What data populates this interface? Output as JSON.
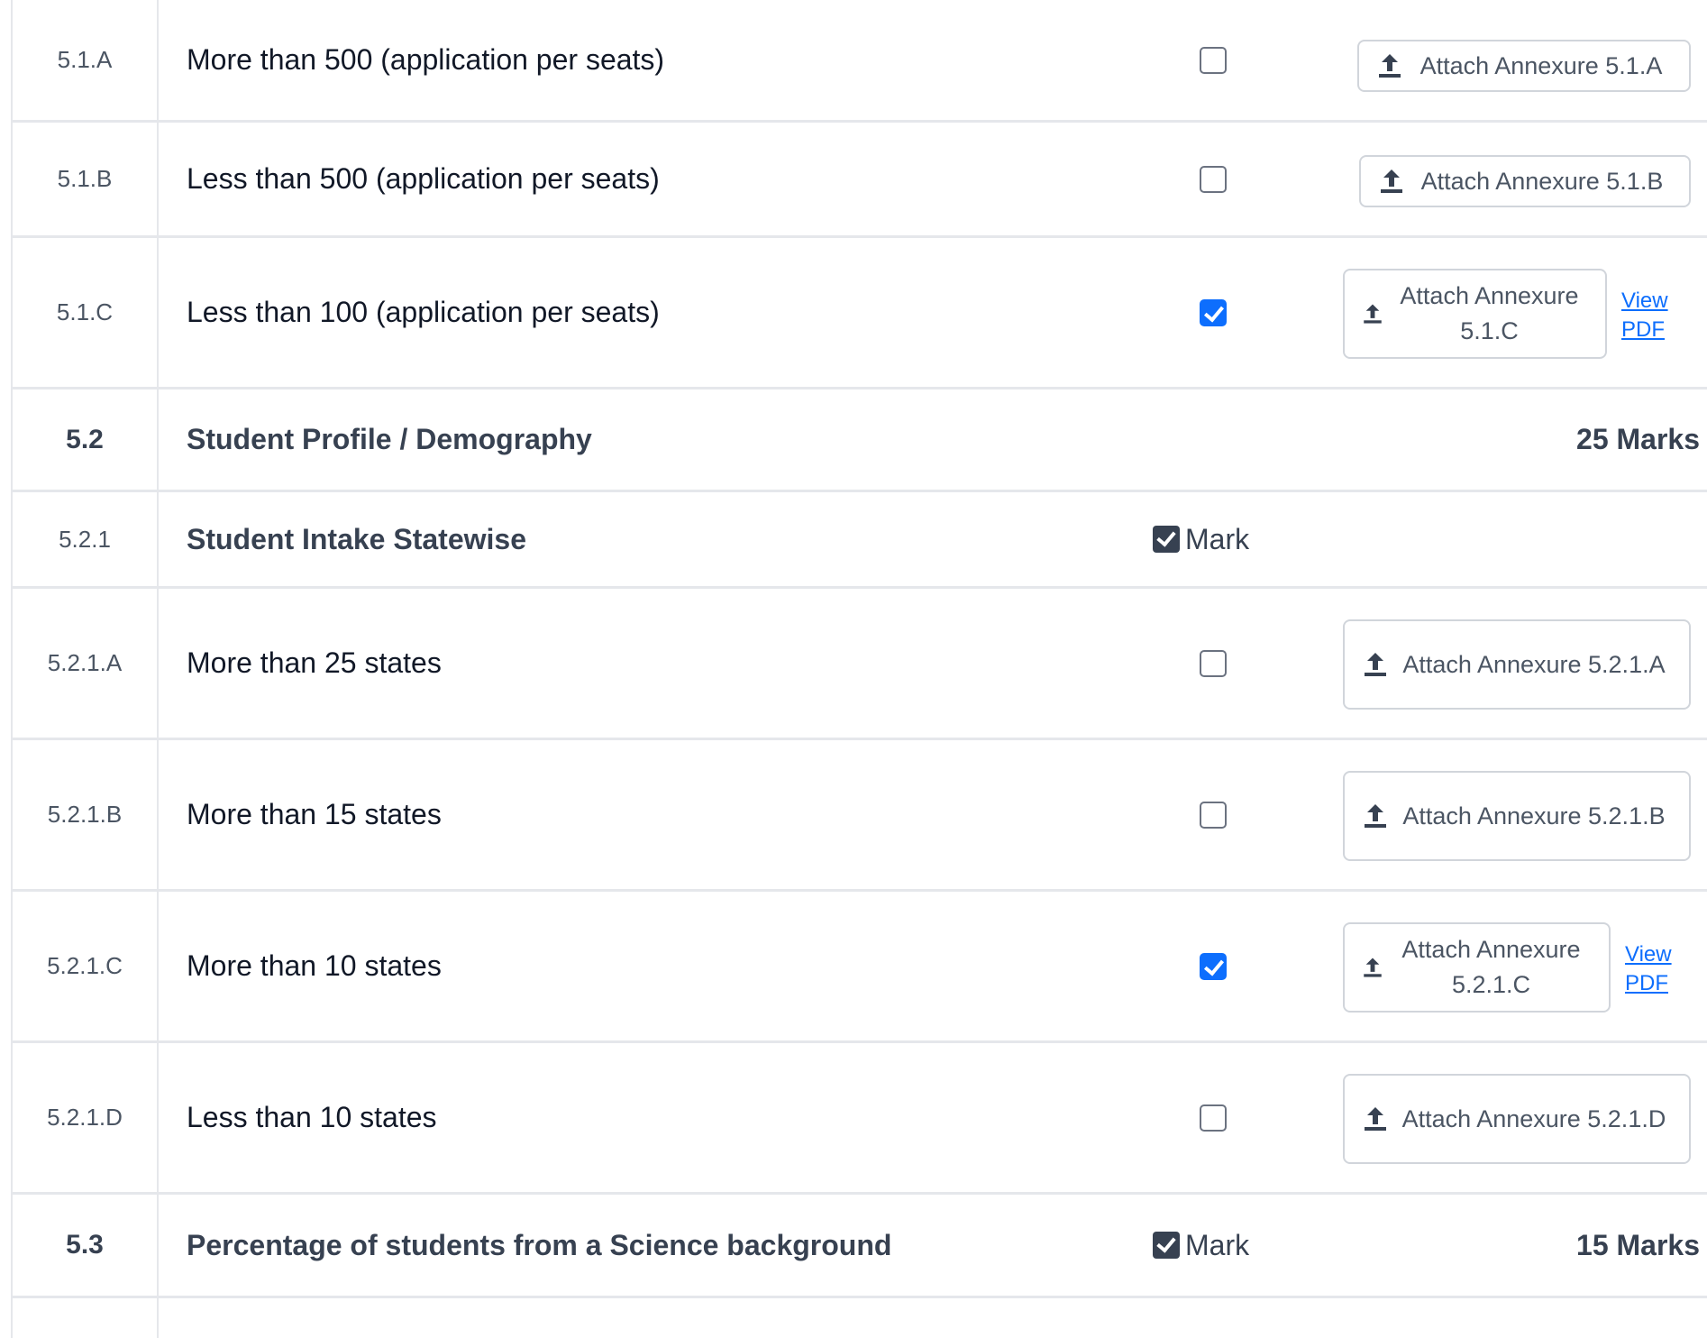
{
  "rows": [
    {
      "code": "5.1.A",
      "desc": "More than 500 (application per seats)",
      "checked": false,
      "attach": "Attach Annexure 5.1.A"
    },
    {
      "code": "5.1.B",
      "desc": "Less than 500 (application per seats)",
      "checked": false,
      "attach": "Attach Annexure 5.1.B"
    },
    {
      "code": "5.1.C",
      "desc": "Less than 100 (application per seats)",
      "checked": true,
      "attach": "Attach Annexure 5.1.C",
      "view": "View PDF"
    },
    {
      "code": "5.2",
      "desc": "Student Profile / Demography",
      "marks": "25 Marks"
    },
    {
      "code": "5.2.1",
      "desc": "Student Intake Statewise",
      "mark_label": "Mark"
    },
    {
      "code": "5.2.1.A",
      "desc": "More than 25 states",
      "checked": false,
      "attach": "Attach Annexure 5.2.1.A"
    },
    {
      "code": "5.2.1.B",
      "desc": "More than 15 states",
      "checked": false,
      "attach": "Attach Annexure 5.2.1.B"
    },
    {
      "code": "5.2.1.C",
      "desc": "More than 10 states",
      "checked": true,
      "attach": "Attach Annexure 5.2.1.C",
      "view": "View PDF"
    },
    {
      "code": "5.2.1.D",
      "desc": "Less than 10 states",
      "checked": false,
      "attach": "Attach Annexure 5.2.1.D"
    },
    {
      "code": "5.3",
      "desc": "Percentage of students from a Science background",
      "mark_label": "Mark",
      "marks": "15 Marks"
    }
  ],
  "colors": {
    "accent": "#0d6efd",
    "text": "#111827",
    "muted": "#4b5563",
    "border": "#e5e7eb"
  },
  "icons": {
    "attach": "upload-icon",
    "mark": "checked-square-icon"
  }
}
